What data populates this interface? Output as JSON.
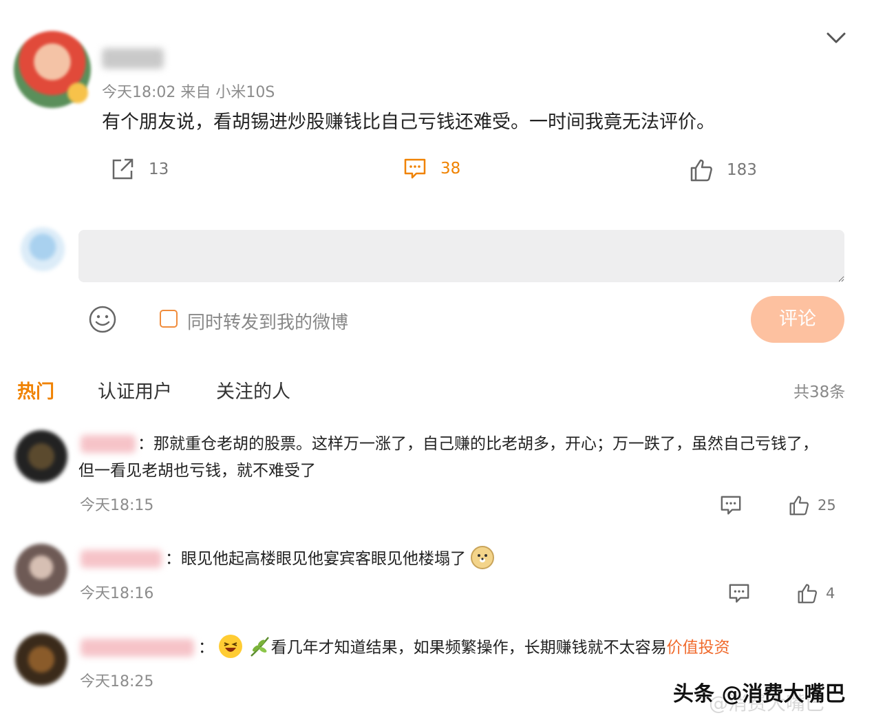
{
  "post": {
    "meta": "今天18:02  来自 小米10S",
    "text": "有个朋友说，看胡锡进炒股赚钱比自己亏钱还难受。一时间我竟无法评价。",
    "repost_count": "13",
    "comment_count": "38",
    "like_count": "183"
  },
  "composer": {
    "placeholder": "",
    "repost_label": "同时转发到我的微博",
    "submit_label": "评论"
  },
  "tabs": [
    {
      "label": "热门"
    },
    {
      "label": "认证用户"
    },
    {
      "label": "关注的人"
    }
  ],
  "total_count": "共38条",
  "comments": [
    {
      "separator": "：",
      "text": "那就重仓老胡的股票。这样万一涨了，自己赚的比老胡多，开心；万一跌了，虽然自己亏钱了，但一看见老胡也亏钱，就不难受了",
      "time": "今天18:15",
      "like_count": "25"
    },
    {
      "separator": "：",
      "text": "眼见他起高楼眼见他宴宾客眼见他楼塌了",
      "time": "今天18:16",
      "like_count": "4"
    },
    {
      "separator": "：",
      "text": "看几年才知道结果，如果频繁操作，长期赚钱就不太容易",
      "link": "价值投资",
      "time": "今天18:25"
    }
  ],
  "watermark": {
    "main": "头条 @消费大嘴巴",
    "ghost": "@消费大嘴巴"
  },
  "colors": {
    "accent": "#f08200",
    "submit_button": "#fdc1a0",
    "link": "#f06a2c",
    "input_bg": "#eeeeef"
  }
}
